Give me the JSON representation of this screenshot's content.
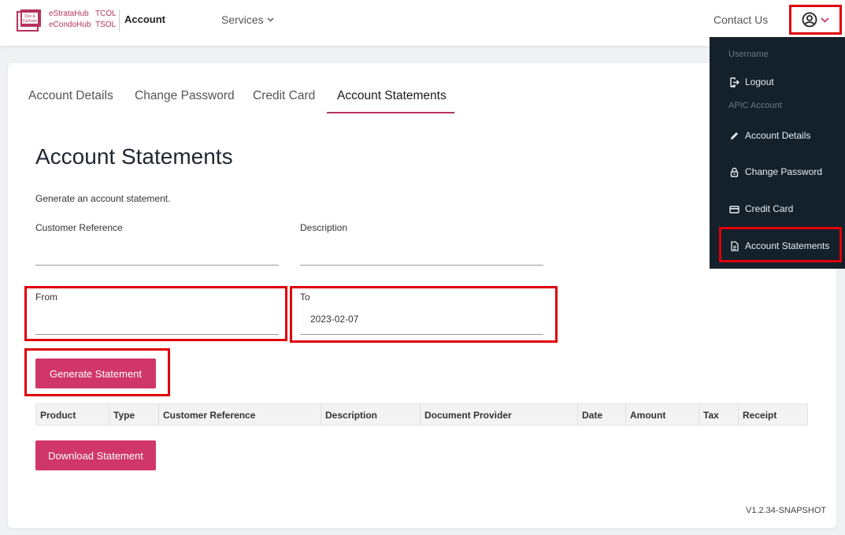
{
  "header": {
    "logo_line1": "eStrataHub",
    "logo_line2": "eCondoHub",
    "logo_code1": "TCOL",
    "logo_code2": "TSOL",
    "app_title": "Account",
    "services_label": "Services",
    "contact_label": "Contact Us"
  },
  "tabs": [
    {
      "label": "Account Details"
    },
    {
      "label": "Change Password"
    },
    {
      "label": "Credit Card"
    },
    {
      "label": "Account Statements"
    }
  ],
  "main": {
    "title": "Account Statements",
    "description": "Generate an account statement.",
    "customer_reference_label": "Customer Reference",
    "customer_reference_value": "",
    "description_label": "Description",
    "description_value": "",
    "from_label": "From",
    "from_value": "",
    "to_label": "To",
    "to_value": "2023-02-07",
    "generate_button": "Generate Statement",
    "download_button": "Download Statement"
  },
  "table": {
    "columns": [
      "Product",
      "Type",
      "Customer Reference",
      "Description",
      "Document Provider",
      "Date",
      "Amount",
      "Tax",
      "Receipt"
    ]
  },
  "footer": {
    "version": "V1.2.34-SNAPSHOT"
  },
  "dropdown": {
    "username_label": "Username",
    "logout": "Logout",
    "account_section": "APIC Account",
    "items": [
      {
        "label": "Account Details",
        "icon": "pencil-icon"
      },
      {
        "label": "Change Password",
        "icon": "lock-icon"
      },
      {
        "label": "Credit Card",
        "icon": "credit-card-icon"
      },
      {
        "label": "Account Statements",
        "icon": "document-icon"
      }
    ]
  },
  "colors": {
    "accent": "#d0366a",
    "dropdown_bg": "#14212b",
    "highlight": "#e0000a"
  }
}
